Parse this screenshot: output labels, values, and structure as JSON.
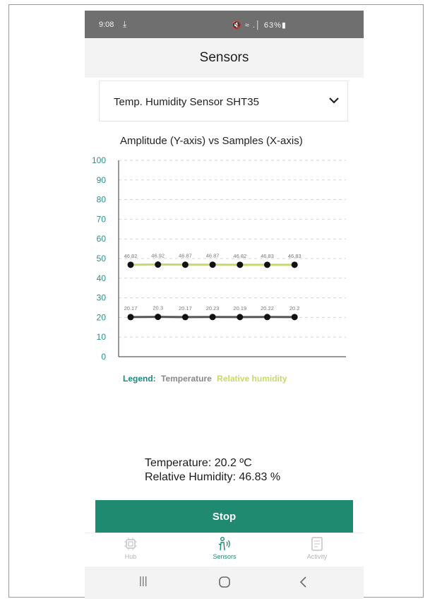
{
  "status_bar": {
    "time": "9:08",
    "download_icon": "download-icon",
    "icons_text": "🔇 ≈ .│ 63%▮",
    "battery": "63%"
  },
  "app_bar": {
    "title": "Sensors"
  },
  "sensor_select": {
    "selected": "Temp. Humidity Sensor SHT35"
  },
  "chart_data": {
    "type": "line",
    "title": "Amplitude (Y-axis) vs Samples (X-axis)",
    "xlabel": "",
    "ylabel": "",
    "ylim": [
      0,
      100
    ],
    "y_ticks": [
      "0",
      "10",
      "20",
      "30",
      "40",
      "50",
      "60",
      "70",
      "80",
      "90",
      "100"
    ],
    "x": [
      1,
      2,
      3,
      4,
      5,
      6,
      7
    ],
    "grid": true,
    "series": [
      {
        "name": "Relative humidity",
        "color": "#c8d96a",
        "values": [
          46.82,
          46.92,
          46.87,
          46.87,
          46.82,
          46.83,
          46.83
        ],
        "labels": [
          "46.82",
          "46.92",
          "46.87",
          "46.87",
          "46.82",
          "46.83",
          "46.83"
        ]
      },
      {
        "name": "Temperature",
        "color": "#555555",
        "values": [
          20.17,
          20.3,
          20.17,
          20.23,
          20.19,
          20.22,
          20.2
        ],
        "labels": [
          "20.17",
          "20.3",
          "20.17",
          "20.23",
          "20.19",
          "20.22",
          "20.2"
        ]
      }
    ]
  },
  "legend": {
    "heading": "Legend:",
    "temperature": "Temperature",
    "humidity": "Relative humidity",
    "heading_color": "#1a8a7a",
    "temperature_color": "#888888",
    "humidity_color": "#c8d96a"
  },
  "readings": {
    "temperature": "Temperature: 20.2 ºC",
    "humidity": "Relative Humidity: 46.83 %"
  },
  "actions": {
    "stop_label": "Stop",
    "accent": "#1f8a70"
  },
  "bottom_nav": [
    {
      "label": "Hub",
      "icon": "chip-icon",
      "active": false
    },
    {
      "label": "Sensors",
      "icon": "sensor-person-icon",
      "active": true
    },
    {
      "label": "Activity",
      "icon": "document-icon",
      "active": false
    }
  ],
  "system_nav": {
    "recents": "|||",
    "home": "home-icon",
    "back": "back-icon"
  }
}
